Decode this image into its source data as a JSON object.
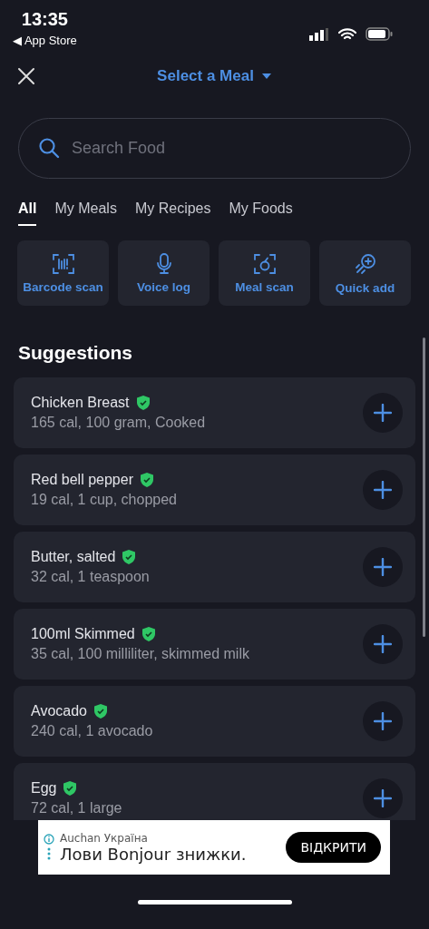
{
  "status_bar": {
    "time": "13:35",
    "back_label": "◀ App Store"
  },
  "header": {
    "title": "Select a Meal"
  },
  "search": {
    "placeholder": "Search Food"
  },
  "tabs": [
    {
      "label": "All",
      "selected": true
    },
    {
      "label": "My Meals",
      "selected": false
    },
    {
      "label": "My Recipes",
      "selected": false
    },
    {
      "label": "My Foods",
      "selected": false
    }
  ],
  "quick_actions": [
    {
      "kind": "barcode",
      "label": "Barcode scan"
    },
    {
      "kind": "voice",
      "label": "Voice log"
    },
    {
      "kind": "meal",
      "label": "Meal scan"
    },
    {
      "kind": "quick",
      "label": "Quick add"
    }
  ],
  "suggestions_title": "Suggestions",
  "suggestions": [
    {
      "name": "Chicken Breast",
      "detail": "165 cal, 100 gram, Cooked",
      "verified": true
    },
    {
      "name": "Red bell pepper",
      "detail": "19 cal, 1 cup, chopped",
      "verified": true
    },
    {
      "name": "Butter, salted",
      "detail": "32 cal, 1 teaspoon",
      "verified": true
    },
    {
      "name": "100ml Skimmed",
      "detail": "35 cal, 100 milliliter, skimmed milk",
      "verified": true
    },
    {
      "name": "Avocado",
      "detail": "240 cal, 1 avocado",
      "verified": true
    },
    {
      "name": "Egg",
      "detail": "72 cal, 1 large",
      "verified": true
    }
  ],
  "ad": {
    "advertiser": "Auchan Україна",
    "headline": "Лови Bonjour знижки.",
    "button": "ВІДКРИТИ"
  }
}
